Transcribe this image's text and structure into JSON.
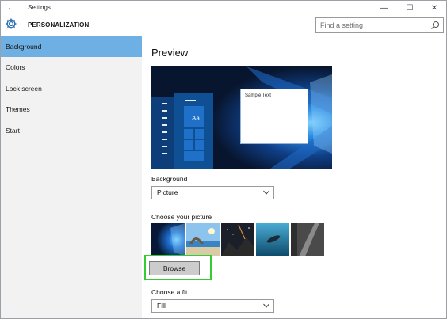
{
  "window": {
    "title": "Settings",
    "minimize_glyph": "—",
    "maximize_glyph": "☐",
    "close_glyph": "✕",
    "back_glyph": "←"
  },
  "header": {
    "section_title": "PERSONALIZATION",
    "search_placeholder": "Find a setting"
  },
  "sidebar": {
    "items": [
      {
        "label": "Background",
        "selected": true
      },
      {
        "label": "Colors",
        "selected": false
      },
      {
        "label": "Lock screen",
        "selected": false
      },
      {
        "label": "Themes",
        "selected": false
      },
      {
        "label": "Start",
        "selected": false
      }
    ]
  },
  "main": {
    "preview_heading": "Preview",
    "preview": {
      "sample_text": "Sample Text",
      "tile_text": "Aa"
    },
    "background_label": "Background",
    "background_value": "Picture",
    "choose_picture_label": "Choose your picture",
    "picture_thumbnails": [
      "windows-hero",
      "beach-arch",
      "night-sky",
      "underwater-swimmer",
      "rock-path"
    ],
    "browse_label": "Browse",
    "fit_label": "Choose a fit",
    "fit_value": "Fill"
  },
  "colors": {
    "accent": "#6fb0e4",
    "highlight_border": "#33cc33",
    "sidebar_bg": "#f2f2f2"
  }
}
